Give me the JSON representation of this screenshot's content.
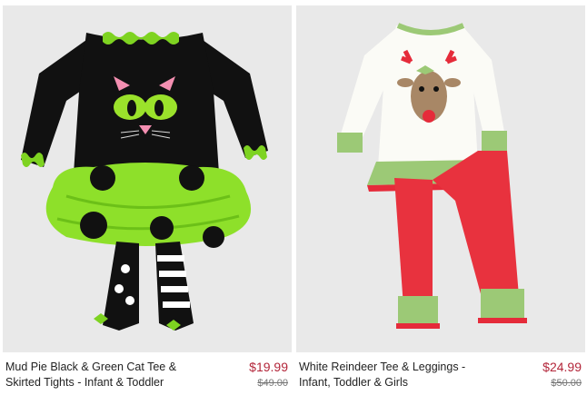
{
  "products": [
    {
      "name": "Mud Pie Black & Green Cat Tee & Skirted Tights - Infant & Toddler",
      "price": "$19.99",
      "original_price": "$49.00",
      "image_icon": "cat-tutu-outfit-image"
    },
    {
      "name": "White Reindeer Tee & Leggings - Infant, Toddler & Girls",
      "price": "$24.99",
      "original_price": "$50.00",
      "image_icon": "reindeer-outfit-image"
    }
  ],
  "colors": {
    "sale_price": "#b3263a",
    "original_price": "#777777",
    "image_background": "#e9e9e9"
  }
}
